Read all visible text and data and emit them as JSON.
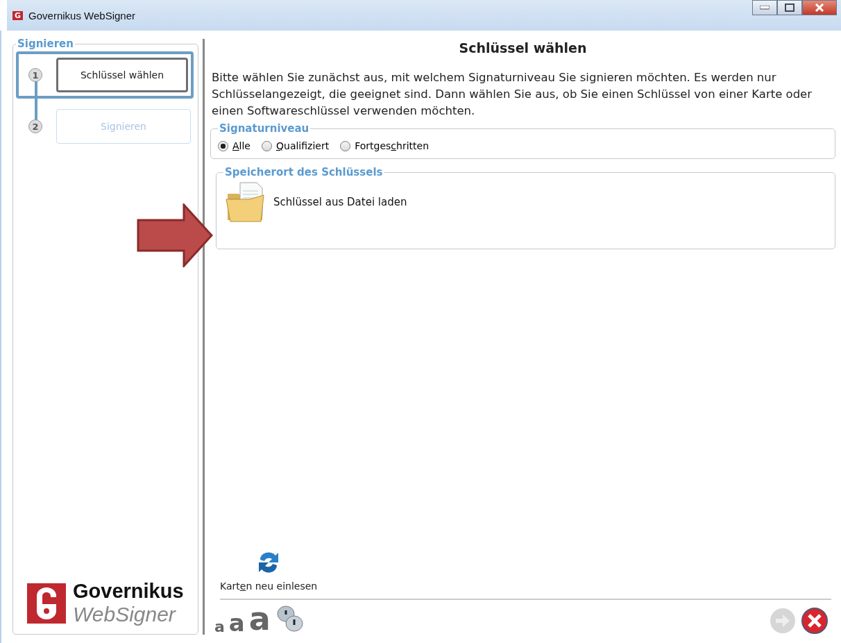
{
  "window": {
    "title": "Governikus WebSigner",
    "app_icon": "G"
  },
  "sidebar": {
    "title": "Signieren",
    "steps": [
      {
        "number": "1",
        "label": "Schlüssel wählen",
        "selected": true
      },
      {
        "number": "2",
        "label": "Signieren",
        "selected": false
      }
    ],
    "logo": {
      "name": "Governikus",
      "product": "WebSigner"
    }
  },
  "main": {
    "heading": "Schlüssel wählen",
    "intro": "Bitte wählen Sie zunächst aus, mit welchem Signaturniveau Sie signieren möchten. Es werden nur Schlüsselangezeigt, die geeignet sind. Dann wählen Sie aus, ob Sie einen Schlüssel von einer Karte oder einen Softwareschlüssel verwenden möchten.",
    "level_group": {
      "title": "Signaturniveau",
      "options": [
        {
          "label": {
            "key": "A",
            "after": "lle"
          },
          "selected": true
        },
        {
          "label": {
            "key": "Q",
            "after": "ualifiziert"
          },
          "selected": false
        },
        {
          "label": {
            "before": "Fortges",
            "key": "c",
            "after": "hritten"
          },
          "selected": false
        }
      ]
    },
    "storage_group": {
      "title": "Speicherort des Schlüssels",
      "items": [
        {
          "label": "Schlüssel aus Datei laden"
        }
      ]
    },
    "reload": {
      "label": {
        "before": "Kart",
        "key": "e",
        "after": "n neu einlesen"
      }
    },
    "font_sizes": [
      "a",
      "a",
      "a"
    ]
  }
}
